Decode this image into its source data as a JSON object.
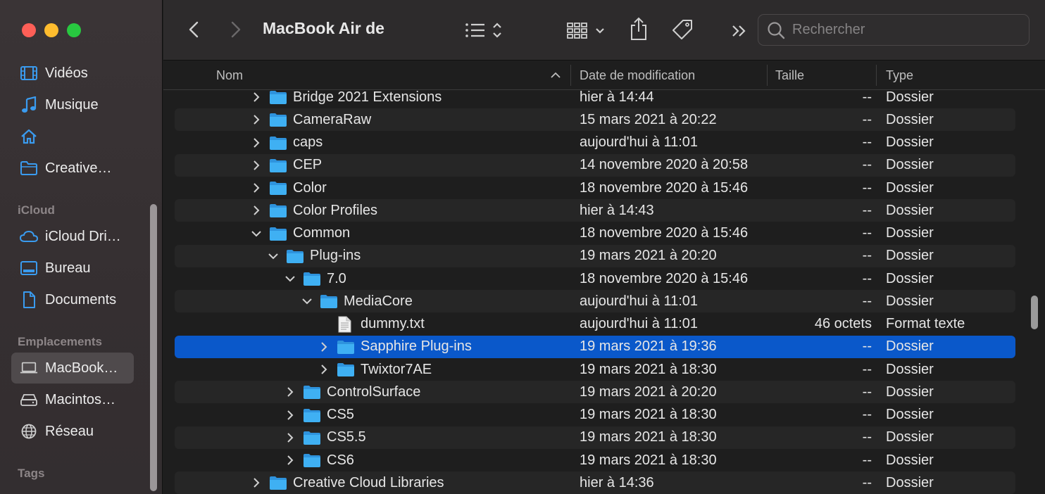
{
  "window": {
    "title": "MacBook Air de"
  },
  "search": {
    "placeholder": "Rechercher"
  },
  "sidebar": {
    "items_top": [
      {
        "label": "Vidéos",
        "icon": "film-icon"
      },
      {
        "label": "Musique",
        "icon": "music-note-icon"
      },
      {
        "label": "",
        "icon": "home-icon"
      },
      {
        "label": "Creative…",
        "icon": "folder-icon"
      }
    ],
    "section_icloud": "iCloud",
    "items_icloud": [
      {
        "label": "iCloud Dri…",
        "icon": "cloud-icon"
      },
      {
        "label": "Bureau",
        "icon": "desktop-icon"
      },
      {
        "label": "Documents",
        "icon": "document-icon"
      }
    ],
    "section_locations": "Emplacements",
    "items_locations": [
      {
        "label": "MacBook…",
        "icon": "laptop-icon",
        "selected": true
      },
      {
        "label": "Macintos…",
        "icon": "disk-icon"
      },
      {
        "label": "Réseau",
        "icon": "network-globe-icon"
      }
    ],
    "section_tags": "Tags"
  },
  "columns": {
    "name": "Nom",
    "date": "Date de modification",
    "size": "Taille",
    "type": "Type"
  },
  "colors": {
    "accent": "#0a58ca",
    "folder": "#3aa8f0"
  },
  "rows": [
    {
      "name": "Bridge 2021 Extensions",
      "date": "hier à 14:44",
      "size": "--",
      "type": "Dossier",
      "depth": 0,
      "expanded": false,
      "kind": "folder"
    },
    {
      "name": "CameraRaw",
      "date": "15 mars 2021 à 20:22",
      "size": "--",
      "type": "Dossier",
      "depth": 0,
      "expanded": false,
      "kind": "folder"
    },
    {
      "name": "caps",
      "date": "aujourd'hui à 11:01",
      "size": "--",
      "type": "Dossier",
      "depth": 0,
      "expanded": false,
      "kind": "folder"
    },
    {
      "name": "CEP",
      "date": "14 novembre 2020 à 20:58",
      "size": "--",
      "type": "Dossier",
      "depth": 0,
      "expanded": false,
      "kind": "folder"
    },
    {
      "name": "Color",
      "date": "18 novembre 2020 à 15:46",
      "size": "--",
      "type": "Dossier",
      "depth": 0,
      "expanded": false,
      "kind": "folder"
    },
    {
      "name": "Color Profiles",
      "date": "hier à 14:43",
      "size": "--",
      "type": "Dossier",
      "depth": 0,
      "expanded": false,
      "kind": "folder"
    },
    {
      "name": "Common",
      "date": "18 novembre 2020 à 15:46",
      "size": "--",
      "type": "Dossier",
      "depth": 0,
      "expanded": true,
      "kind": "folder"
    },
    {
      "name": "Plug-ins",
      "date": "19 mars 2021 à 20:20",
      "size": "--",
      "type": "Dossier",
      "depth": 1,
      "expanded": true,
      "kind": "folder"
    },
    {
      "name": "7.0",
      "date": "18 novembre 2020 à 15:46",
      "size": "--",
      "type": "Dossier",
      "depth": 2,
      "expanded": true,
      "kind": "folder"
    },
    {
      "name": "MediaCore",
      "date": "aujourd'hui à 11:01",
      "size": "--",
      "type": "Dossier",
      "depth": 3,
      "expanded": true,
      "kind": "folder"
    },
    {
      "name": "dummy.txt",
      "date": "aujourd'hui à 11:01",
      "size": "46 octets",
      "type": "Format texte",
      "depth": 4,
      "kind": "file"
    },
    {
      "name": "Sapphire Plug-ins",
      "date": "19 mars 2021 à 19:36",
      "size": "--",
      "type": "Dossier",
      "depth": 4,
      "expanded": false,
      "kind": "folder",
      "selected": true
    },
    {
      "name": "Twixtor7AE",
      "date": "19 mars 2021 à 18:30",
      "size": "--",
      "type": "Dossier",
      "depth": 4,
      "expanded": false,
      "kind": "folder"
    },
    {
      "name": "ControlSurface",
      "date": "19 mars 2021 à 20:20",
      "size": "--",
      "type": "Dossier",
      "depth": 2,
      "expanded": false,
      "kind": "folder"
    },
    {
      "name": "CS5",
      "date": "19 mars 2021 à 18:30",
      "size": "--",
      "type": "Dossier",
      "depth": 2,
      "expanded": false,
      "kind": "folder"
    },
    {
      "name": "CS5.5",
      "date": "19 mars 2021 à 18:30",
      "size": "--",
      "type": "Dossier",
      "depth": 2,
      "expanded": false,
      "kind": "folder"
    },
    {
      "name": "CS6",
      "date": "19 mars 2021 à 18:30",
      "size": "--",
      "type": "Dossier",
      "depth": 2,
      "expanded": false,
      "kind": "folder"
    },
    {
      "name": "Creative Cloud Libraries",
      "date": "hier à 14:36",
      "size": "--",
      "type": "Dossier",
      "depth": 0,
      "expanded": false,
      "kind": "folder"
    }
  ]
}
